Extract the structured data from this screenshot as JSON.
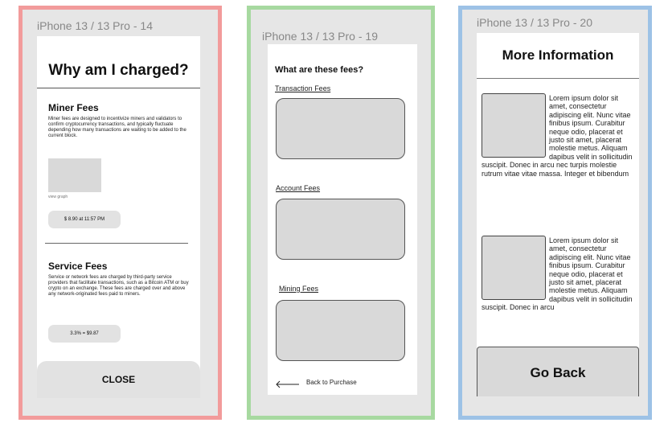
{
  "frames": [
    {
      "label": "iPhone 13 / 13 Pro - 14",
      "border_color": "#f29b9b",
      "title": "Why am I charged?",
      "miner": {
        "heading": "Miner Fees",
        "body": "Miner fees are designed to incentivize miners and validators to confirm cryptocurrency transactions, and typically fluctuate depending how many transactions are waiting to be added to the current block.",
        "graph_caption": "view graph",
        "pill": "$ 8.90 at 11:57 PM"
      },
      "service": {
        "heading": "Service Fees",
        "body": "Service or network fees are charged by third-party service providers that facilitate transactions, such as a Bitcoin ATM or buy crypto on an exchange. These fees are charged over and above any network-originated fees paid to miners.",
        "pill": "3.3% = $9.87"
      },
      "close_label": "CLOSE"
    },
    {
      "label": "iPhone 13 / 13 Pro - 19",
      "border_color": "#a7d9a0",
      "title": "What are these fees?",
      "links": [
        "Transaction Fees",
        "Account Fees",
        "Mining Fees"
      ],
      "back_label": "Back to Purchase"
    },
    {
      "label": "iPhone 13 / 13 Pro - 20",
      "border_color": "#9dc2e6",
      "title": "More Information",
      "block1": "Lorem ipsum dolor sit amet, consectetur adipiscing elit. Nunc vitae finibus ipsum. Curabitur neque odio, placerat et justo sit amet, placerat molestie metus. Aliquam dapibus velit in sollicitudin suscipit. Donec in arcu nec turpis molestie rutrum vitae vitae massa. Integer et bibendum",
      "block2": "Lorem ipsum dolor sit amet, consectetur adipiscing elit. Nunc vitae finibus ipsum. Curabitur neque odio, placerat et justo sit amet, placerat molestie metus. Aliquam dapibus velit in sollicitudin suscipit. Donec in arcu",
      "go_back_label": "Go Back"
    }
  ]
}
